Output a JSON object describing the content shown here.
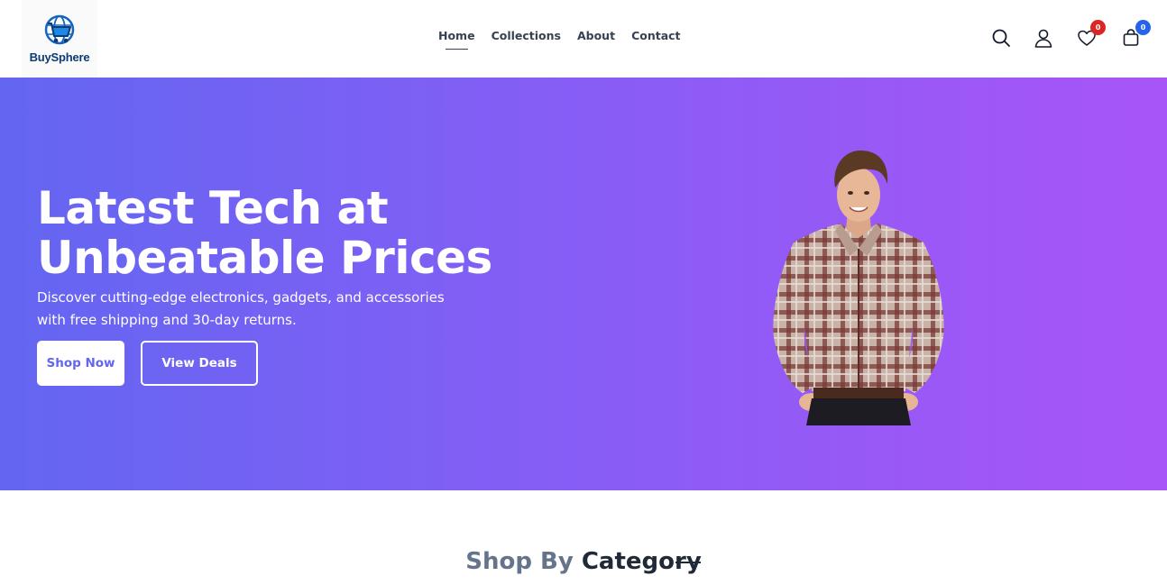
{
  "brand": {
    "name": "BuySphere",
    "icon": "globe-cart-icon",
    "color": "#0b3b75"
  },
  "nav": {
    "items": [
      {
        "label": "Home",
        "active": true
      },
      {
        "label": "Collections",
        "active": false
      },
      {
        "label": "About",
        "active": false
      },
      {
        "label": "Contact",
        "active": false
      }
    ]
  },
  "header_icons": {
    "search": {
      "icon": "search-icon"
    },
    "account": {
      "icon": "user-icon"
    },
    "wishlist": {
      "icon": "heart-icon",
      "count": "0",
      "badge_color": "#dc2626"
    },
    "cart": {
      "icon": "shopping-bag-icon",
      "count": "0",
      "badge_color": "#2563eb"
    }
  },
  "hero": {
    "title_line1": "Latest Tech at",
    "title_line2": "Unbeatable Prices",
    "subtitle_line1": "Discover cutting-edge electronics, gadgets, and accessories",
    "subtitle_line2": "with free shipping and 30-day returns.",
    "primary_button": "Shop Now",
    "secondary_button": "View Deals",
    "gradient_start": "#6366f1",
    "gradient_end": "#a855f7",
    "image": "man-in-plaid-shirt-image"
  },
  "category_section": {
    "title_part1": "Shop By",
    "title_part2": "Category"
  }
}
